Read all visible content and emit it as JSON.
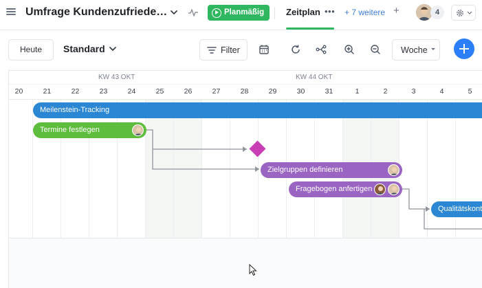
{
  "header": {
    "project_title": "Umfrage Kundenzufriede…",
    "status_label": "Planmäßig",
    "active_tab": "Zeitplan",
    "tab_more_dots": "•••",
    "more_tabs": "+ 7 weitere",
    "add_tab": "+",
    "member_count": "4"
  },
  "toolbar": {
    "today_label": "Heute",
    "view_label": "Standard",
    "filter_label": "Filter",
    "scale_label": "Woche"
  },
  "timeline": {
    "weeks": [
      "KW 43 OKT",
      "KW 44 OKT"
    ],
    "days": [
      "20",
      "21",
      "22",
      "23",
      "24",
      "25",
      "26",
      "27",
      "28",
      "29",
      "30",
      "31",
      "1",
      "2",
      "3",
      "4",
      "5"
    ],
    "weekend_days": [
      "25",
      "26",
      "1",
      "2"
    ],
    "tasks": [
      {
        "name": "Meilenstein-Tracking",
        "color": "#2b86d4",
        "start_day": "21",
        "end_day": "5",
        "assignees": 0
      },
      {
        "name": "Termine festlegen",
        "color": "#5fbd3d",
        "start_day": "21",
        "end_day": "24",
        "assignees": 1
      },
      {
        "name": "Zielgruppen definieren",
        "color": "#9a64c2",
        "start_day": "29",
        "end_day": "2",
        "assignees": 1
      },
      {
        "name": "Fragebogen anfertigen",
        "color": "#9a64c2",
        "start_day": "28",
        "end_day": "2",
        "assignees": 2
      },
      {
        "name": "Qualitätskont",
        "color": "#2b86d4",
        "start_day": "3",
        "end_day": "5",
        "assignees": 0
      }
    ],
    "milestone_color": "#c83fb4"
  },
  "icons": {
    "menu": "hamburger-icon",
    "caret": "chevron-down-icon",
    "activity": "activity-icon",
    "play": "play-circle-icon",
    "settings": "gear-icon",
    "filter": "filter-icon",
    "calendar": "calendar-icon",
    "refresh": "refresh-icon",
    "dependencies": "share-icon",
    "zoom_in": "zoom-in-icon",
    "zoom_out": "zoom-out-icon",
    "add": "plus-icon"
  }
}
